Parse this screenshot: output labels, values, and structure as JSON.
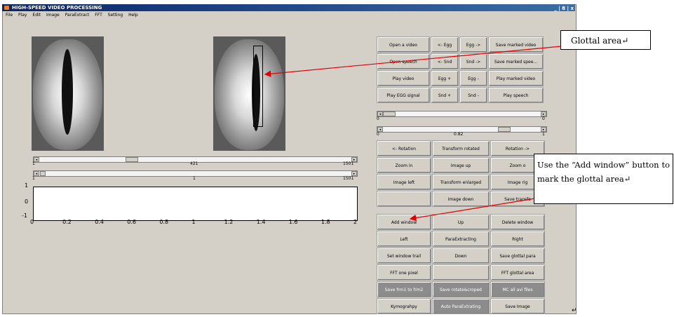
{
  "window": {
    "title": "HIGH-SPEED VIDEO PROCESSING",
    "controls": "_ | 8 | x"
  },
  "menu": [
    "File",
    "Play",
    "Edit",
    "Image",
    "ParaExtract",
    "FFT",
    "Setting",
    "Help"
  ],
  "sliders": {
    "frame_main": {
      "min": "1",
      "value": "421",
      "max": "1501"
    },
    "frame_range": {
      "min": "1",
      "value": "1",
      "max": "1501"
    },
    "right_top": {
      "min": "0",
      "max": "0"
    },
    "right_second": {
      "min": "0",
      "value": "0.82",
      "max": "1"
    }
  },
  "plot": {
    "y_ticks": [
      "1",
      "0",
      "-1"
    ],
    "x_ticks": [
      "0",
      "0.2",
      "0.4",
      "0.6",
      "0.8",
      "1",
      "1.2",
      "1.4",
      "1.6",
      "1.8",
      "2"
    ]
  },
  "buttons_top": [
    [
      "Open a video",
      "<- Egg",
      "Egg ->",
      "Save marked video"
    ],
    [
      "Open speech",
      "<- Snd",
      "Snd ->",
      "Save marked spee..."
    ],
    [
      "Play video",
      "Egg +",
      "Egg -",
      "Play marked video"
    ],
    [
      "Play EGG signal",
      "Snd +",
      "Snd -",
      "Play speech"
    ]
  ],
  "buttons_mid": [
    [
      "<- Rotation",
      "Transform rotated",
      "Rotation ->"
    ],
    [
      "Zoom in",
      "Image up",
      "Zoom o"
    ],
    [
      "Image left",
      "Transform enlarged",
      "Image rig"
    ],
    [
      "",
      "Image down",
      "Save transfo"
    ]
  ],
  "buttons_bottom": [
    [
      "Add window",
      "Up",
      "Delete window"
    ],
    [
      "Left",
      "ParaExtracting",
      "Right"
    ],
    [
      "Set window trail",
      "Down",
      "Save glottal para"
    ],
    [
      "FFT one pixel",
      "",
      "FFT glottal area"
    ],
    [
      "Save frm1 to frm2",
      "Save rotate&croped",
      "MC all avi files"
    ],
    [
      "Kymograhpy",
      "Auto ParaExtrating",
      "Save Image"
    ]
  ],
  "callouts": {
    "glottal": "Glottal area↵",
    "addwindow": "Use the “Add window” button to mark the glottal area↵"
  },
  "colors": {
    "title_bar": "#0a246a",
    "annotation_arrow": "#e00000",
    "dark_button": "#8c8c8c"
  }
}
